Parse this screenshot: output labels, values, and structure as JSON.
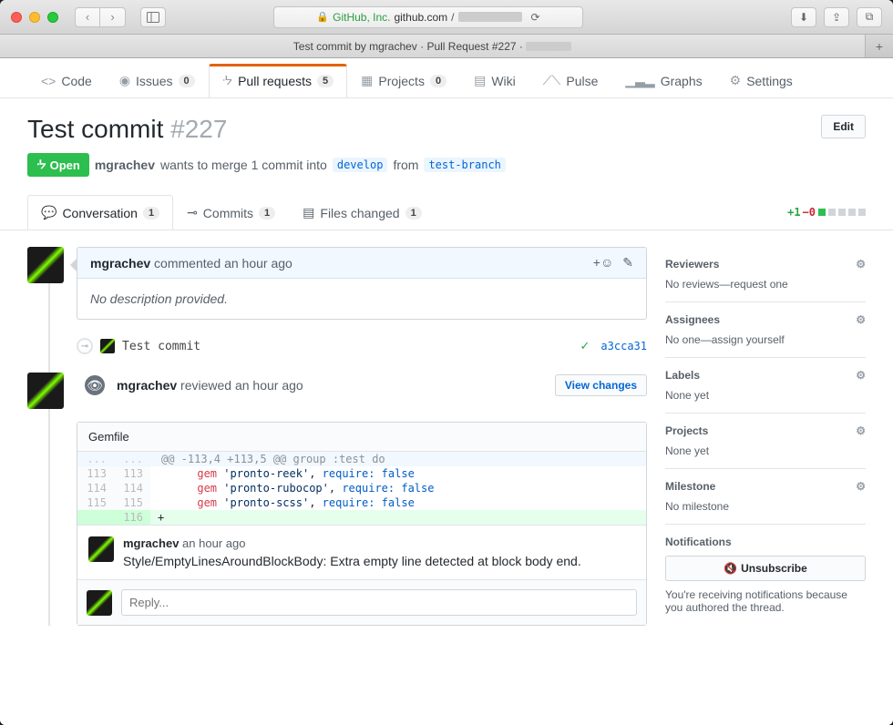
{
  "browser": {
    "url_org": "GitHub, Inc.",
    "url_domain": "github.com",
    "tab_title": "Test commit by mgrachev · Pull Request #227 ·"
  },
  "repo_tabs": {
    "code": "Code",
    "issues": "Issues",
    "issues_count": "0",
    "pulls": "Pull requests",
    "pulls_count": "5",
    "projects": "Projects",
    "projects_count": "0",
    "wiki": "Wiki",
    "pulse": "Pulse",
    "graphs": "Graphs",
    "settings": "Settings"
  },
  "pr": {
    "title": "Test commit",
    "number": "#227",
    "edit": "Edit",
    "state": "Open",
    "author": "mgrachev",
    "merge_text_1": "wants to merge 1 commit into",
    "base": "develop",
    "merge_text_2": "from",
    "head": "test-branch"
  },
  "subtabs": {
    "conversation": "Conversation",
    "conversation_count": "1",
    "commits": "Commits",
    "commits_count": "1",
    "files": "Files changed",
    "files_count": "1"
  },
  "diffstat": {
    "add": "+1",
    "del": "−0"
  },
  "timeline": {
    "comment1": {
      "author": "mgrachev",
      "action": "commented",
      "time": "an hour ago",
      "body": "No description provided.",
      "reaction": "+☺"
    },
    "commit1": {
      "message": "Test commit",
      "hash": "a3cca31"
    },
    "review1": {
      "author": "mgrachev",
      "action": "reviewed",
      "time": "an hour ago",
      "view_changes": "View changes"
    },
    "file": {
      "name": "Gemfile",
      "hunk": "@@ -113,4 +113,5 @@ group :test do",
      "lines": [
        {
          "ol": "113",
          "nl": "113",
          "kw": "gem",
          "str": "'pronto-reek'",
          "rest": ", ",
          "sym": "require:",
          "val": " false"
        },
        {
          "ol": "114",
          "nl": "114",
          "kw": "gem",
          "str": "'pronto-rubocop'",
          "rest": ", ",
          "sym": "require:",
          "val": " false"
        },
        {
          "ol": "115",
          "nl": "115",
          "kw": "gem",
          "str": "'pronto-scss'",
          "rest": ", ",
          "sym": "require:",
          "val": " false"
        }
      ],
      "added": {
        "nl": "116",
        "mark": "+"
      }
    },
    "inline": {
      "author": "mgrachev",
      "time": "an hour ago",
      "body": "Style/EmptyLinesAroundBlockBody: Extra empty line detected at block body end."
    },
    "reply_placeholder": "Reply..."
  },
  "sidebar": {
    "reviewers": {
      "title": "Reviewers",
      "body": "No reviews—request one"
    },
    "assignees": {
      "title": "Assignees",
      "body_pre": "No one—",
      "body_link": "assign yourself"
    },
    "labels": {
      "title": "Labels",
      "body": "None yet"
    },
    "projects": {
      "title": "Projects",
      "body": "None yet"
    },
    "milestone": {
      "title": "Milestone",
      "body": "No milestone"
    },
    "notifications": {
      "title": "Notifications",
      "button": "Unsubscribe",
      "desc": "You're receiving notifications because you authored the thread."
    }
  }
}
